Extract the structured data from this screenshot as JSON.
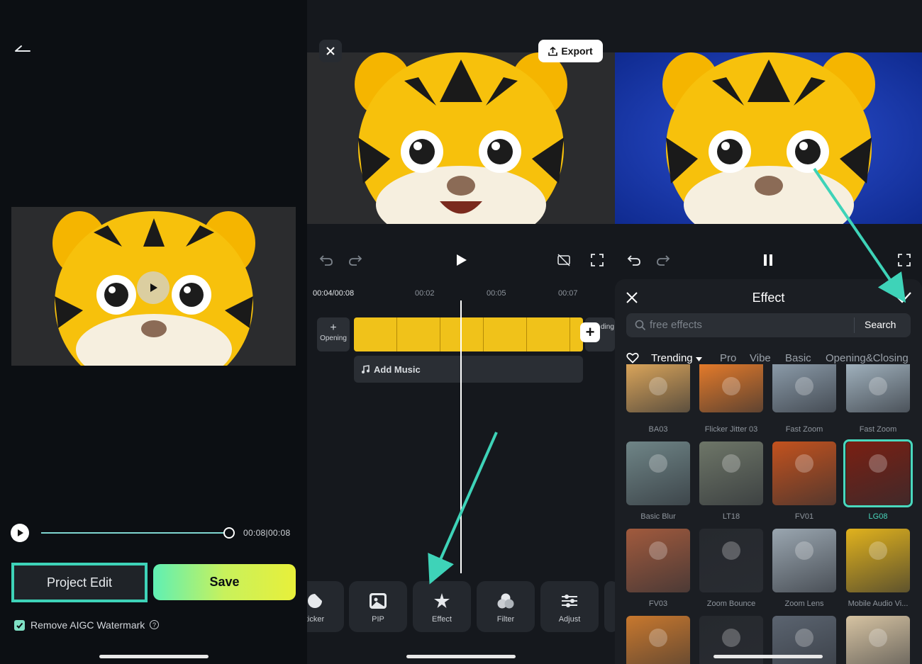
{
  "left_panel": {
    "time": "00:08|00:08",
    "project_edit_label": "Project Edit",
    "save_label": "Save",
    "watermark_label": "Remove AIGC Watermark",
    "help_glyph": "?",
    "watermark_checked": true,
    "progress": 1.0
  },
  "editor": {
    "export_label": "Export",
    "timecode": "00:04/00:08",
    "ticks": [
      "00:02",
      "00:05",
      "00:07"
    ],
    "opening_label": "Opening",
    "ending_label": "ding",
    "add_music_label": "Add Music",
    "tools": [
      {
        "icon": "sticker-icon",
        "label": "ticker"
      },
      {
        "icon": "pip-icon",
        "label": "PIP"
      },
      {
        "icon": "effect-icon",
        "label": "Effect"
      },
      {
        "icon": "filter-icon",
        "label": "Filter"
      },
      {
        "icon": "adjust-icon",
        "label": "Adjust"
      }
    ]
  },
  "effect_panel": {
    "title": "Effect",
    "search_placeholder": "free effects",
    "search_button": "Search",
    "categories": [
      "Trending",
      "Pro",
      "Vibe",
      "Basic",
      "Opening&Closing"
    ],
    "active_category": "Trending",
    "items": [
      {
        "label": "BA03",
        "color": "#d9a45a"
      },
      {
        "label": "Flicker Jitter 03",
        "color": "#e37a2a"
      },
      {
        "label": "Fast Zoom",
        "color": "#8a9aa8"
      },
      {
        "label": "Fast Zoom",
        "color": "#9fb0bc"
      },
      {
        "label": "Basic Blur",
        "color": "#6f8587"
      },
      {
        "label": "LT18",
        "color": "#6e7668"
      },
      {
        "label": "FV01",
        "color": "#c3521e"
      },
      {
        "label": "LG08",
        "color": "#7a1f12",
        "selected": true
      },
      {
        "label": "FV03",
        "color": "#a15a3d"
      },
      {
        "label": "Zoom Bounce",
        "color": "#26292e"
      },
      {
        "label": "Zoom Lens",
        "color": "#9aa6b0"
      },
      {
        "label": "Mobile Audio Vi...",
        "color": "#e1b21d"
      },
      {
        "label": "",
        "color": "#c8782e"
      },
      {
        "label": "",
        "color": "#26292e"
      },
      {
        "label": "",
        "color": "#5b6470"
      },
      {
        "label": "",
        "color": "#d6c3a2"
      }
    ],
    "accent": "#49d8bd"
  }
}
